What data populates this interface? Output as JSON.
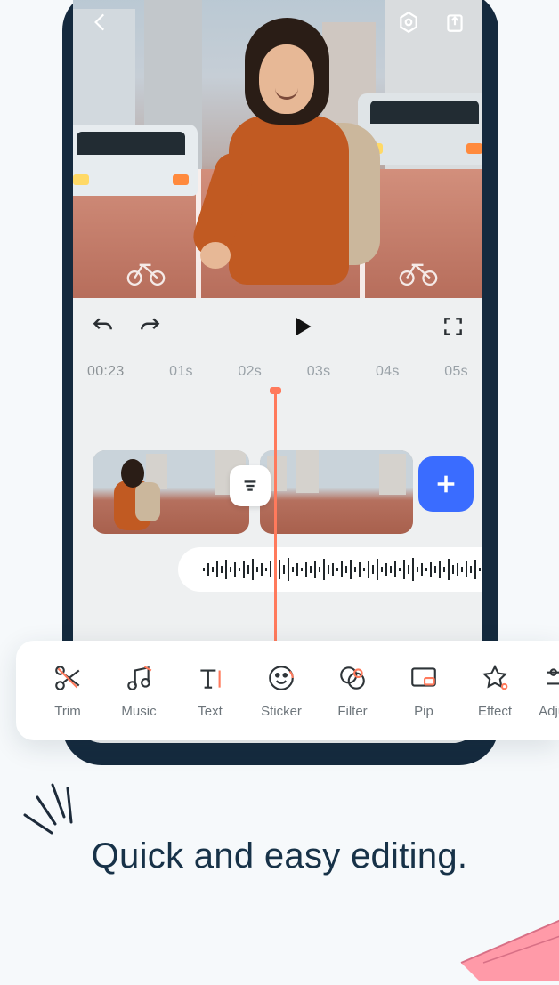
{
  "preview": {
    "back_icon": "back-icon",
    "settings_icon": "hex-settings-icon",
    "export_icon": "export-icon"
  },
  "controls": {
    "undo_icon": "undo-icon",
    "redo_icon": "redo-icon",
    "play_icon": "play-icon",
    "fullscreen_icon": "fullscreen-icon"
  },
  "ruler": {
    "current": "00:23",
    "marks": [
      "01s",
      "02s",
      "03s",
      "04s",
      "05s"
    ]
  },
  "timeline": {
    "transition_icon": "transition-icon",
    "add_icon": "plus-icon",
    "audio_icon": "music-note-icon"
  },
  "tools": [
    {
      "key": "trim",
      "label": "Trim"
    },
    {
      "key": "music",
      "label": "Music"
    },
    {
      "key": "text",
      "label": "Text"
    },
    {
      "key": "sticker",
      "label": "Sticker"
    },
    {
      "key": "filter",
      "label": "Filter"
    },
    {
      "key": "pip",
      "label": "Pip"
    },
    {
      "key": "effect",
      "label": "Effect"
    },
    {
      "key": "adjust",
      "label": "Adjust"
    }
  ],
  "headline": "Quick and easy editing.",
  "colors": {
    "accent": "#ff7a5c",
    "primary_blue": "#3a6cff",
    "ink": "#173248"
  }
}
